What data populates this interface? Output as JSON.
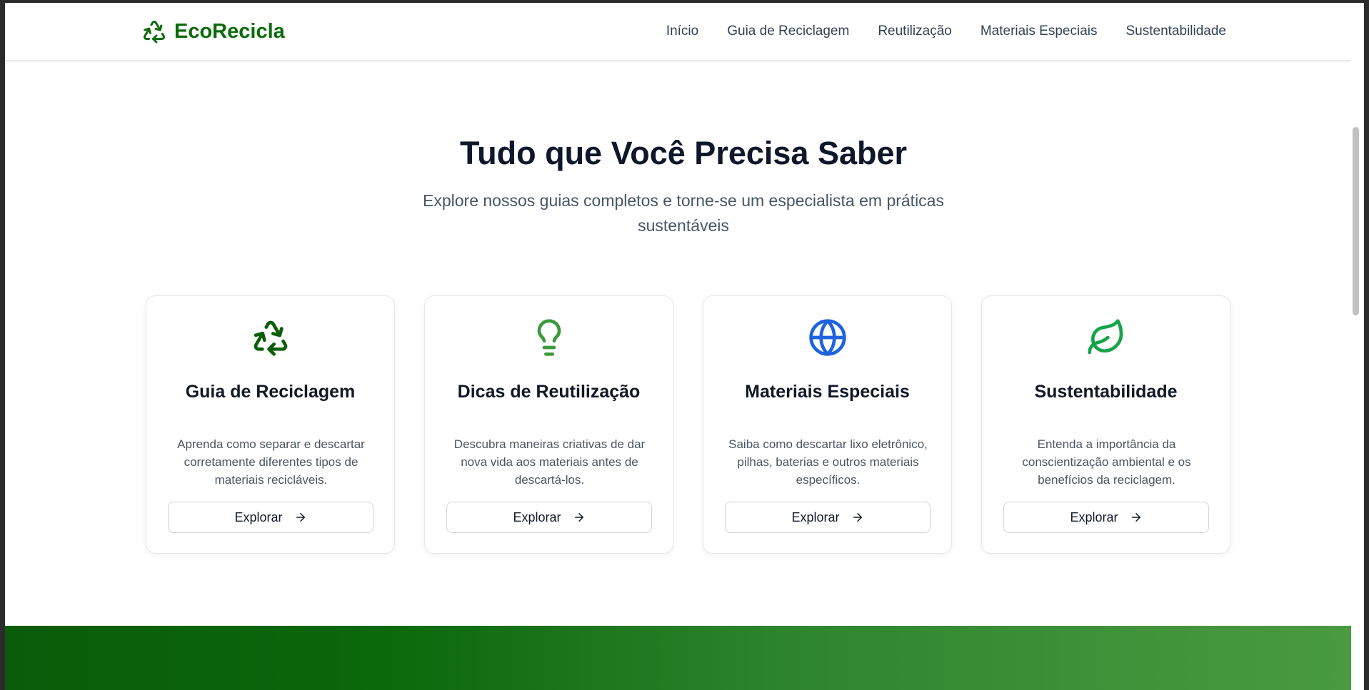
{
  "brand": {
    "name": "EcoRecicla",
    "icon": "recycle-icon",
    "color": "#0b6b0b"
  },
  "nav": {
    "links": [
      {
        "label": "Início"
      },
      {
        "label": "Guia de Reciclagem"
      },
      {
        "label": "Reutilização"
      },
      {
        "label": "Materiais Especiais"
      },
      {
        "label": "Sustentabilidade"
      }
    ]
  },
  "hero": {
    "title": "Tudo que Você Precisa Saber",
    "subtitle": "Explore nossos guias completos e torne-se um especialista em práticas sustentáveis"
  },
  "cards": [
    {
      "icon": "recycle-icon",
      "icon_color": "#0b5d0b",
      "title": "Guia de Reciclagem",
      "description": "Aprenda como separar e descartar corretamente diferentes tipos de materiais recicláveis.",
      "button": "Explorar"
    },
    {
      "icon": "lightbulb-icon",
      "icon_color": "#3b9a3b",
      "title": "Dicas de Reutilização",
      "description": "Descubra maneiras criativas de dar nova vida aos materiais antes de descartá-los.",
      "button": "Explorar"
    },
    {
      "icon": "globe-icon",
      "icon_color": "#1d63e0",
      "title": "Materiais Especiais",
      "description": "Saiba como descartar lixo eletrônico, pilhas, baterias e outros materiais específicos.",
      "button": "Explorar"
    },
    {
      "icon": "leaf-icon",
      "icon_color": "#17a34a",
      "title": "Sustentabilidade",
      "description": "Entenda a importância da conscientização ambiental e os benefícios da reciclagem.",
      "button": "Explorar"
    }
  ]
}
